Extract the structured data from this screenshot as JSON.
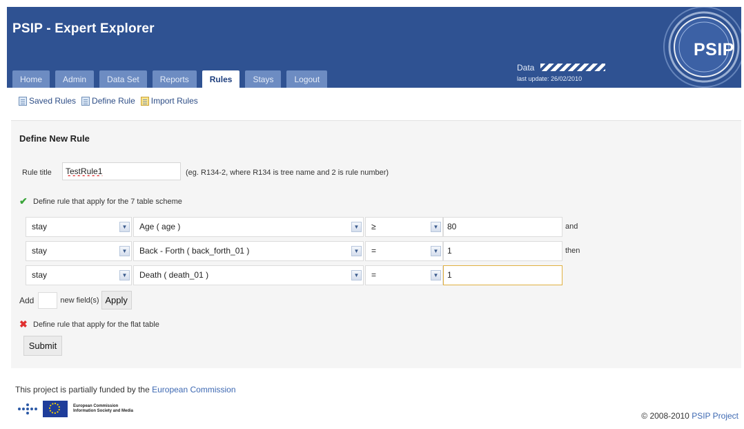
{
  "header": {
    "title": "PSIP - Expert Explorer",
    "tabs": [
      {
        "label": "Home"
      },
      {
        "label": "Admin"
      },
      {
        "label": "Data Set"
      },
      {
        "label": "Reports"
      },
      {
        "label": "Rules",
        "active": true
      },
      {
        "label": "Stays"
      },
      {
        "label": "Logout"
      }
    ],
    "data_label": "Data",
    "last_update": "last update: 26/02/2010",
    "logo_text": "PSIP"
  },
  "subnav": {
    "saved_rules": "Saved Rules",
    "define_rule": "Define Rule",
    "import_rules": "Import Rules"
  },
  "form": {
    "heading": "Define New Rule",
    "rule_title_label": "Rule title",
    "rule_title_value": "TestRule1",
    "rule_title_hint": "(eg. R134-2, where R134 is tree name and 2 is rule number)",
    "tree_section_label": "Define rule that apply for the 7 table scheme",
    "rows": [
      {
        "type": "stay",
        "field": "Age ( age )",
        "operator": "≥",
        "value": "80",
        "conjunction": "and"
      },
      {
        "type": "stay",
        "field": "Back - Forth ( back_forth_01 )",
        "operator": "=",
        "value": "1",
        "conjunction": "then"
      },
      {
        "type": "stay",
        "field": "Death ( death_01 )",
        "operator": "=",
        "value": "1",
        "conjunction": ""
      }
    ],
    "add_label": "Add",
    "add_suffix": "new field(s)",
    "apply_label": "Apply",
    "flat_section_label": "Define rule that apply for the flat table",
    "submit_label": "Submit"
  },
  "footer": {
    "funding_prefix": "This project is partially funded by the",
    "funding_link": "European Commission",
    "eu_line1": "European Commission",
    "eu_line2": "Information Society and Media",
    "copyright_prefix": "© 2008-2010",
    "copyright_link": "PSIP Project"
  },
  "colors": {
    "header_bg": "#2f5292",
    "tab_bg": "#6d8cc2",
    "link": "#3d68b2",
    "panel_bg": "#f5f5f5"
  }
}
